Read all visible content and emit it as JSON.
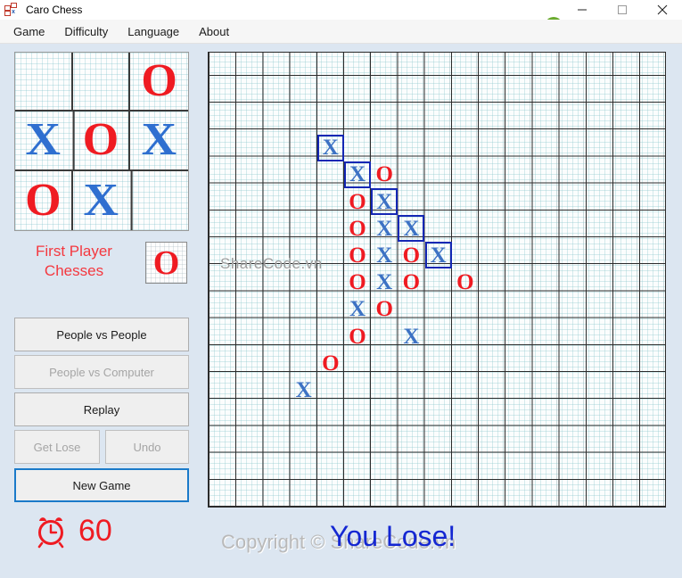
{
  "window": {
    "title": "Caro Chess",
    "app_icon": "caro-chess-icon",
    "controls": [
      {
        "name": "minimize",
        "glyph": "minimize-icon"
      },
      {
        "name": "maximize",
        "glyph": "maximize-icon"
      },
      {
        "name": "close",
        "glyph": "close-icon"
      }
    ]
  },
  "branding": {
    "logo_icon": "sharecode-logo-icon",
    "part1": "SHARE",
    "part2": "CODE",
    "part3": ".vn",
    "color_green": "#6aab2e",
    "color_gray": "#8a8a8a"
  },
  "menubar": {
    "items": [
      {
        "label": "Game"
      },
      {
        "label": "Difficulty"
      },
      {
        "label": "Language"
      },
      {
        "label": "About"
      }
    ]
  },
  "preview": {
    "caption": "tic-tac-toe-preview",
    "cells": [
      "",
      "",
      "O",
      "X",
      "O",
      "X",
      "O",
      "X",
      ""
    ]
  },
  "status": {
    "first_player_line1": "First Player",
    "first_player_line2": "Chesses",
    "first_player_mark": "O",
    "first_player_color": "#f4383f"
  },
  "buttons": {
    "people_vs_people": "People vs People",
    "people_vs_computer": "People vs Computer",
    "replay": "Replay",
    "get_lose": "Get Lose",
    "undo": "Undo",
    "new_game": "New Game"
  },
  "timer": {
    "icon": "alarm-clock-icon",
    "value": "60",
    "color": "#ef1b22"
  },
  "board": {
    "columns": 17,
    "rows": 17,
    "cell_size": 30.2,
    "watermark": "ShareCode.vn",
    "pieces": [
      {
        "col": 4,
        "row": 3,
        "mark": "X",
        "win": true
      },
      {
        "col": 5,
        "row": 4,
        "mark": "X",
        "win": true
      },
      {
        "col": 6,
        "row": 4,
        "mark": "O",
        "win": false
      },
      {
        "col": 5,
        "row": 5,
        "mark": "O",
        "win": false
      },
      {
        "col": 6,
        "row": 5,
        "mark": "X",
        "win": true
      },
      {
        "col": 5,
        "row": 6,
        "mark": "O",
        "win": false
      },
      {
        "col": 6,
        "row": 6,
        "mark": "X",
        "win": false
      },
      {
        "col": 7,
        "row": 6,
        "mark": "X",
        "win": true
      },
      {
        "col": 5,
        "row": 7,
        "mark": "O",
        "win": false
      },
      {
        "col": 6,
        "row": 7,
        "mark": "X",
        "win": false
      },
      {
        "col": 7,
        "row": 7,
        "mark": "O",
        "win": false
      },
      {
        "col": 8,
        "row": 7,
        "mark": "X",
        "win": true
      },
      {
        "col": 5,
        "row": 8,
        "mark": "O",
        "win": false
      },
      {
        "col": 6,
        "row": 8,
        "mark": "X",
        "win": false
      },
      {
        "col": 7,
        "row": 8,
        "mark": "O",
        "win": false
      },
      {
        "col": 9,
        "row": 8,
        "mark": "O",
        "win": false
      },
      {
        "col": 5,
        "row": 9,
        "mark": "X",
        "win": false
      },
      {
        "col": 6,
        "row": 9,
        "mark": "O",
        "win": false
      },
      {
        "col": 5,
        "row": 10,
        "mark": "O",
        "win": false
      },
      {
        "col": 7,
        "row": 10,
        "mark": "X",
        "win": false
      },
      {
        "col": 4,
        "row": 11,
        "mark": "O",
        "win": false
      },
      {
        "col": 3,
        "row": 12,
        "mark": "X",
        "win": false
      }
    ]
  },
  "footer": {
    "copyright": "Copyright © ShareCode.vn",
    "result": "You Lose!",
    "result_color": "#1427d2"
  }
}
